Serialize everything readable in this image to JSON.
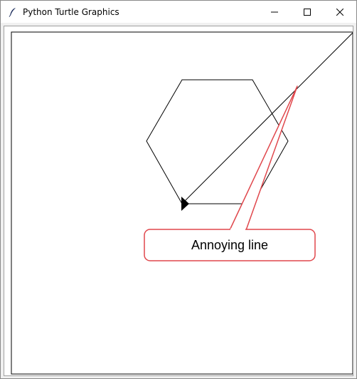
{
  "window": {
    "title": "Python Turtle Graphics",
    "icon": "feather-icon",
    "controls": {
      "minimize_icon": "minimize-icon",
      "maximize_icon": "maximize-icon",
      "close_icon": "close-icon"
    }
  },
  "annotation": {
    "label": "Annoying line",
    "border_color": "#e0474c"
  },
  "colors": {
    "titlebar": "#ffffff",
    "canvas": "#ffffff",
    "frame": "#f0f0f0",
    "drawing": "#000000"
  }
}
